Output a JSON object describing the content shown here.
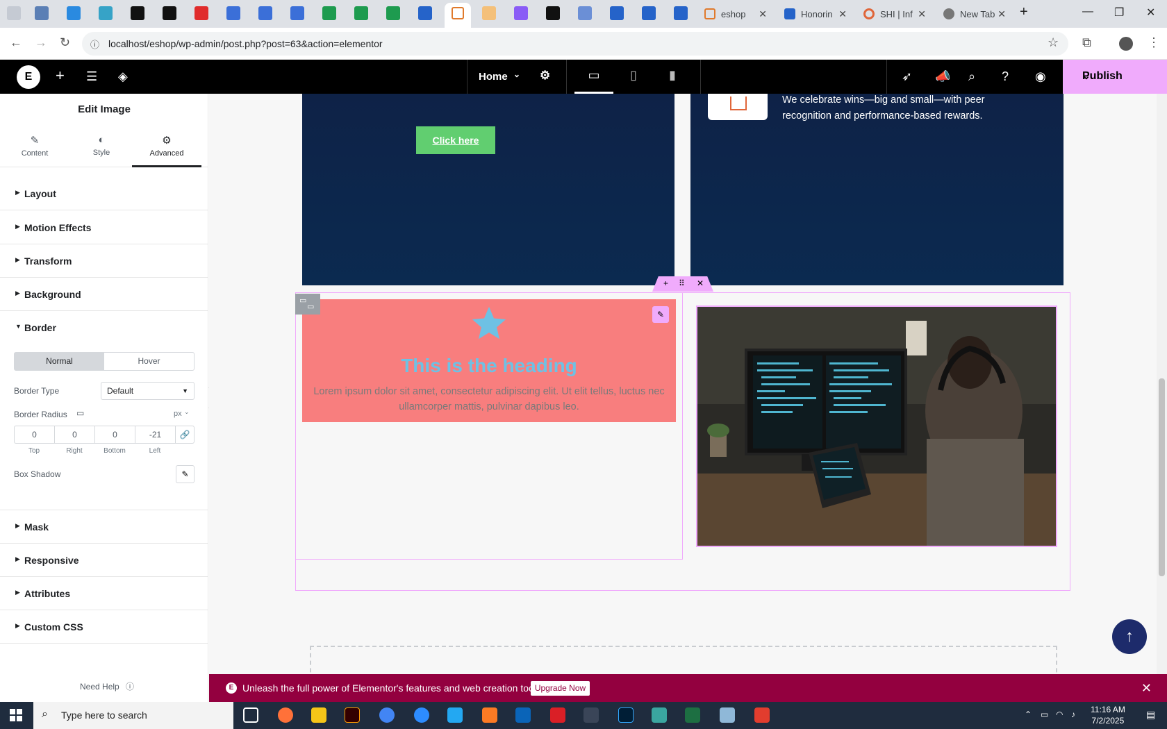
{
  "browser": {
    "tabs": [
      {
        "title": "eshop"
      },
      {
        "title": "Honorin"
      },
      {
        "title": "SHI | Inf"
      },
      {
        "title": "New Tab"
      }
    ],
    "url": "localhost/eshop/wp-admin/post.php?post=63&action=elementor"
  },
  "topbar": {
    "page_name": "Home",
    "publish_label": "Publish"
  },
  "panel": {
    "title": "Edit Image",
    "tabs": [
      {
        "label": "Content"
      },
      {
        "label": "Style"
      },
      {
        "label": "Advanced"
      }
    ],
    "sections": {
      "layout": "Layout",
      "motion": "Motion Effects",
      "transform": "Transform",
      "background": "Background",
      "border": "Border",
      "mask": "Mask",
      "responsive": "Responsive",
      "attributes": "Attributes",
      "custom_css": "Custom CSS"
    },
    "border": {
      "state_normal": "Normal",
      "state_hover": "Hover",
      "type_label": "Border Type",
      "type_value": "Default",
      "radius_label": "Border Radius",
      "radius_unit": "px",
      "radius_top": "0",
      "radius_right": "0",
      "radius_bottom": "0",
      "radius_left": "-21",
      "label_top": "Top",
      "label_right": "Right",
      "label_bottom": "Bottom",
      "label_left": "Left",
      "box_shadow_label": "Box Shadow"
    },
    "need_help": "Need Help"
  },
  "canvas": {
    "cta_label": "Click here",
    "feature_text": "We celebrate wins—big and small—with peer recognition and performance-based rewards.",
    "iconbox_heading": "This is the heading",
    "iconbox_text": "Lorem ipsum dolor sit amet, consectetur adipiscing elit. Ut elit tellus, luctus nec ullamcorper mattis, pulvinar dapibus leo."
  },
  "promo": {
    "message": "Unleash the full power of Elementor's features and web creation tools.",
    "button": "Upgrade Now"
  },
  "taskbar": {
    "search_placeholder": "Type here to search",
    "time": "11:16 AM",
    "date": "7/2/2025"
  },
  "colors": {
    "elementor_black": "#000000",
    "publish_bg": "#f0abfc",
    "cta_green": "#61ce70",
    "iconbox_bg": "#f87e7e",
    "heading_blue": "#6ec1e4",
    "promo_bg": "#93003f",
    "dark_section": "#0e2247"
  }
}
